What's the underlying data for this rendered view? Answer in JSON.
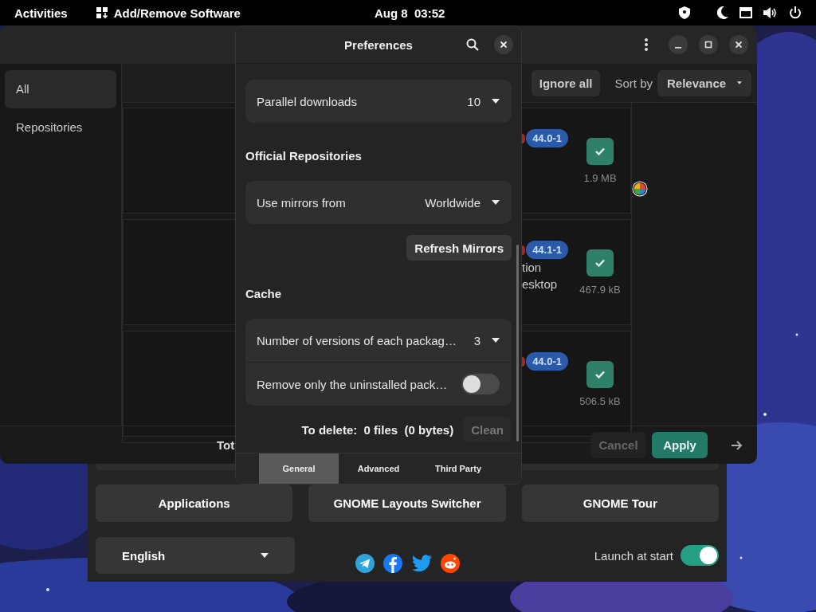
{
  "top_bar": {
    "activities": "Activities",
    "app_name": "Add/Remove Software",
    "clock": "Aug 8  03:52"
  },
  "main_window": {
    "sidebar": [
      {
        "label": "All",
        "selected": true
      },
      {
        "label": "Repositories",
        "selected": false
      }
    ],
    "toolbar": {
      "ignore_all": "Ignore all",
      "sort_label": "Sort by",
      "sort_value": "Relevance"
    },
    "packages": [
      {
        "version": "44.0-1",
        "checked": true,
        "size": "1.9 MB"
      },
      {
        "version": "44.1-1",
        "description": [
          "tion",
          "esktop"
        ],
        "checked": true,
        "size": "467.9 kB"
      },
      {
        "version": "44.0-1",
        "checked": true,
        "size": "506.5 kB"
      }
    ],
    "footer": {
      "total": "Tot",
      "cancel": {
        "label": "Cancel",
        "disabled": true
      },
      "apply": "Apply"
    }
  },
  "preferences": {
    "title": "Preferences",
    "parallel_downloads": {
      "label": "Parallel downloads",
      "value": "10"
    },
    "official_repositories": {
      "heading": "Official Repositories",
      "mirrors_label": "Use mirrors from",
      "mirrors_value": "Worldwide",
      "refresh": "Refresh Mirrors"
    },
    "cache": {
      "heading": "Cache",
      "versions_label": "Number of versions of each packag…",
      "versions_value": "3",
      "remove_uninstalled": {
        "label": "Remove only the uninstalled pack…",
        "on": false
      },
      "to_delete": "To delete:  0 files  (0 bytes)",
      "clean": {
        "label": "Clean",
        "disabled": true
      }
    },
    "tabs": [
      {
        "label": "General",
        "selected": true
      },
      {
        "label": "Advanced",
        "selected": false
      },
      {
        "label": "Third Party",
        "selected": false
      }
    ]
  },
  "welcome": {
    "buttons": [
      "Applications",
      "GNOME Layouts Switcher",
      "GNOME Tour"
    ],
    "language": "English",
    "launch_at_start": {
      "label": "Launch at start",
      "on": true
    }
  }
}
